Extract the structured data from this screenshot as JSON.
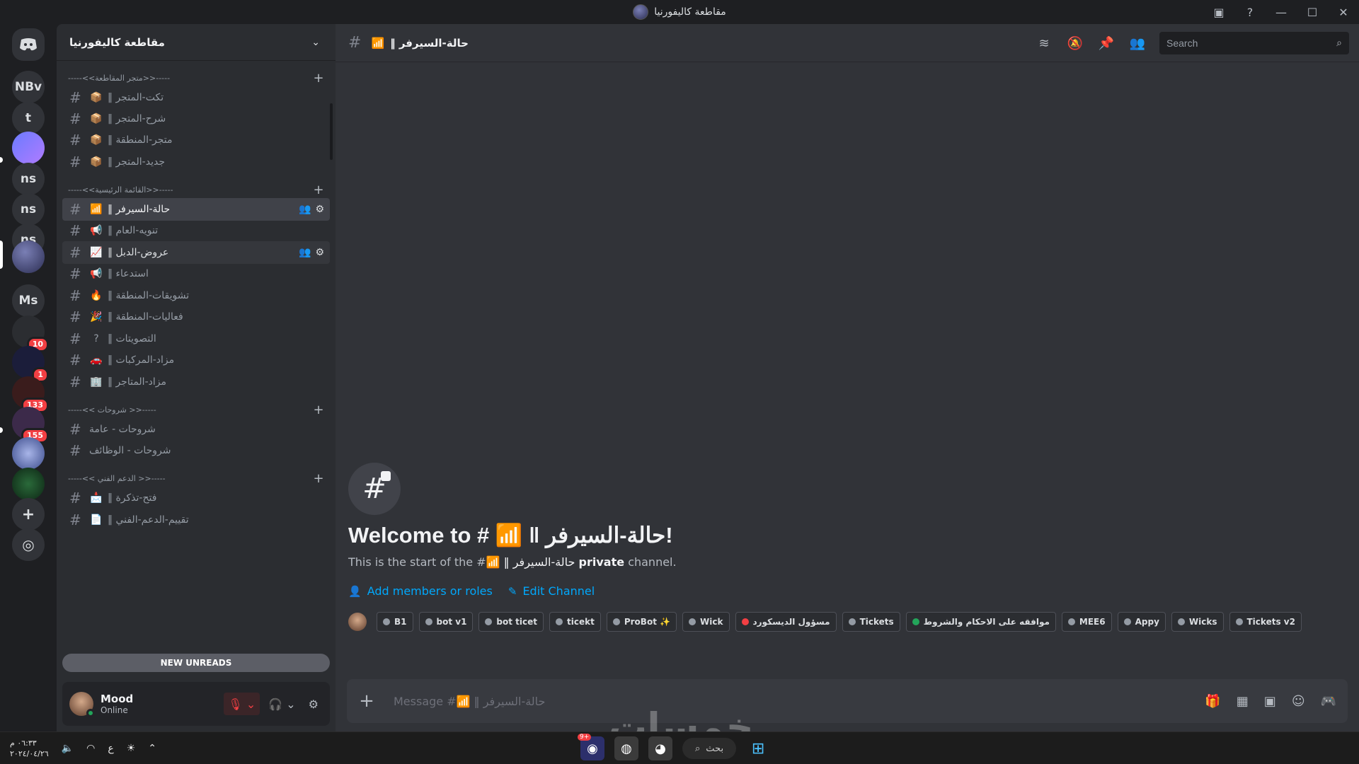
{
  "window": {
    "title": "مقاطعة كاليفورنيا"
  },
  "rail": {
    "servers": [
      {
        "label": "NBv"
      },
      {
        "label": "t"
      },
      {
        "label": "ns"
      },
      {
        "label": "ns"
      },
      {
        "label": "ns"
      },
      {
        "label": "Ms"
      }
    ],
    "badges": {
      "b1": "10",
      "b2": "1",
      "b3": "133",
      "b4": "155"
    },
    "add_label": "+",
    "discover_label": "◎"
  },
  "server": {
    "name": "مقاطعة كاليفورنيا"
  },
  "categories": [
    {
      "label": "-----<<متجر المقاطعة>>-----"
    },
    {
      "label": "-----<<القائمة الرئيسية>>-----"
    },
    {
      "label": "-----<< شروحات >>-----"
    },
    {
      "label": "-----<< الدعم الفني >>-----"
    }
  ],
  "channels": [
    {
      "emoji": "📦",
      "name": "تكت-المتجر ‖"
    },
    {
      "emoji": "📦",
      "name": "شرح-المتجر ‖"
    },
    {
      "emoji": "📦",
      "name": "متجر-المنطقة ‖"
    },
    {
      "emoji": "📦",
      "name": "جديد-المتجر ‖"
    },
    {
      "emoji": "📶",
      "name": "حالة-السيرفر ‖"
    },
    {
      "emoji": "📢",
      "name": "تنويه-العام ‖"
    },
    {
      "emoji": "📈",
      "name": "عروض-الدبل ‖"
    },
    {
      "emoji": "📢",
      "name": "استدعاء ‖"
    },
    {
      "emoji": "🔥",
      "name": "تشويقات-المنطقة ‖"
    },
    {
      "emoji": "🎉",
      "name": "فعاليات-المنطقة ‖"
    },
    {
      "emoji": "?",
      "name": "التصويتات ‖"
    },
    {
      "emoji": "🚗",
      "name": "مزاد-المركبات ‖"
    },
    {
      "emoji": "🏢",
      "name": "مزاد-المتاجر ‖"
    },
    {
      "emoji": "",
      "name": "شروحات - عامة"
    },
    {
      "emoji": "",
      "name": "شروحات - الوظائف"
    },
    {
      "emoji": "📩",
      "name": "فتح-تذكرة ‖"
    },
    {
      "emoji": "📄",
      "name": "تقييم-الدعم-الفني ‖"
    }
  ],
  "new_unreads_label": "NEW UNREADS",
  "user": {
    "name": "Mood",
    "status": "Online"
  },
  "header": {
    "emoji": "📶",
    "channel_name": "حالة-السيرفر ‖",
    "search_placeholder": "Search"
  },
  "welcome": {
    "prefix": "Welcome to # ",
    "emoji": "📶",
    "channel_name": "حالة-السيرفر ‖",
    "suffix": "!",
    "sub_prefix": "This is the start of the #",
    "sub_emoji": "📶",
    "sub_channel": "حالة-السيرفر ‖",
    "sub_private": "private",
    "sub_suffix": "channel.",
    "add_members_label": "Add members or roles",
    "edit_channel_label": "Edit Channel"
  },
  "member_chips": [
    {
      "label": "B1",
      "color": "#949ba4"
    },
    {
      "label": "bot v1",
      "color": "#949ba4"
    },
    {
      "label": "bot ticet",
      "color": "#949ba4"
    },
    {
      "label": "ticekt",
      "color": "#949ba4"
    },
    {
      "label": "ProBot ✨",
      "color": "#949ba4"
    },
    {
      "label": "Wick",
      "color": "#949ba4"
    },
    {
      "label": "مسؤول الديسكورد",
      "color": "#f23f43"
    },
    {
      "label": "Tickets",
      "color": "#949ba4"
    },
    {
      "label": "موافقه على الاحكام والشروط",
      "color": "#23a55a"
    },
    {
      "label": "MEE6",
      "color": "#949ba4"
    },
    {
      "label": "Appy",
      "color": "#949ba4"
    },
    {
      "label": "Wicks",
      "color": "#949ba4"
    },
    {
      "label": "Tickets v2",
      "color": "#949ba4"
    }
  ],
  "composer": {
    "placeholder": "Message #📶 ‖ حالة-السيرفر"
  },
  "taskbar": {
    "time": "٠٦:٣٣ م",
    "date": "٢٠٢٤/٠٤/٢٦",
    "lang": "ع",
    "search_label": "بحث",
    "discord_badge": "9+"
  },
  "watermark": "خمسات"
}
